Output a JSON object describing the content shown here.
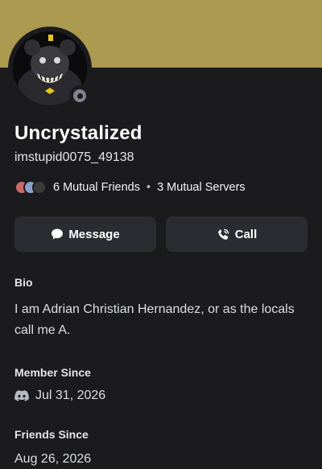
{
  "profile": {
    "display_name": "Uncrystalized",
    "username": "imstupid0075_49138",
    "status": "offline"
  },
  "mutuals": {
    "friends": "6 Mutual Friends",
    "separator": "•",
    "servers": "3 Mutual Servers"
  },
  "actions": {
    "message_label": "Message",
    "call_label": "Call"
  },
  "bio": {
    "label": "Bio",
    "text": "I am Adrian Christian Hernandez, or as the locals call me A."
  },
  "member_since": {
    "label": "Member Since",
    "date": "Jul 31, 2026",
    "icon": "discord-icon"
  },
  "friends_since": {
    "label": "Friends Since",
    "date": "Aug 26, 2026"
  },
  "colors": {
    "banner": "#ab9a4f",
    "background": "#1b1b1e",
    "button": "#2b2c31",
    "status_offline": "#80848e"
  }
}
